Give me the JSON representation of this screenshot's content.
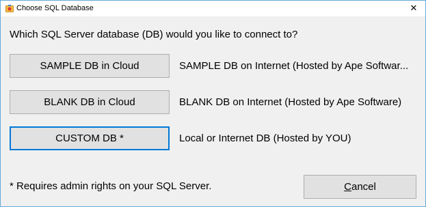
{
  "window": {
    "title": "Choose SQL Database",
    "close_glyph": "✕",
    "icon": "app-icon",
    "border_color": "#64a9d9"
  },
  "prompt": "Which SQL Server database (DB) would you like to connect to?",
  "options": [
    {
      "button_label": "SAMPLE DB in Cloud",
      "description": "SAMPLE DB on Internet (Hosted by Ape Softwar..."
    },
    {
      "button_label": "BLANK DB in Cloud",
      "description": "BLANK DB on Internet (Hosted by Ape Software)"
    },
    {
      "button_label": "CUSTOM DB *",
      "description": "Local or Internet DB (Hosted by YOU)",
      "focused": true
    }
  ],
  "footnote": "* Requires admin rights on your SQL Server.",
  "cancel": {
    "mnemonic": "C",
    "rest": "ancel"
  },
  "colors": {
    "dialog_bg": "#f0f0f0",
    "button_bg": "#e1e1e1",
    "button_border": "#adadad",
    "focus_border": "#0078d7"
  }
}
